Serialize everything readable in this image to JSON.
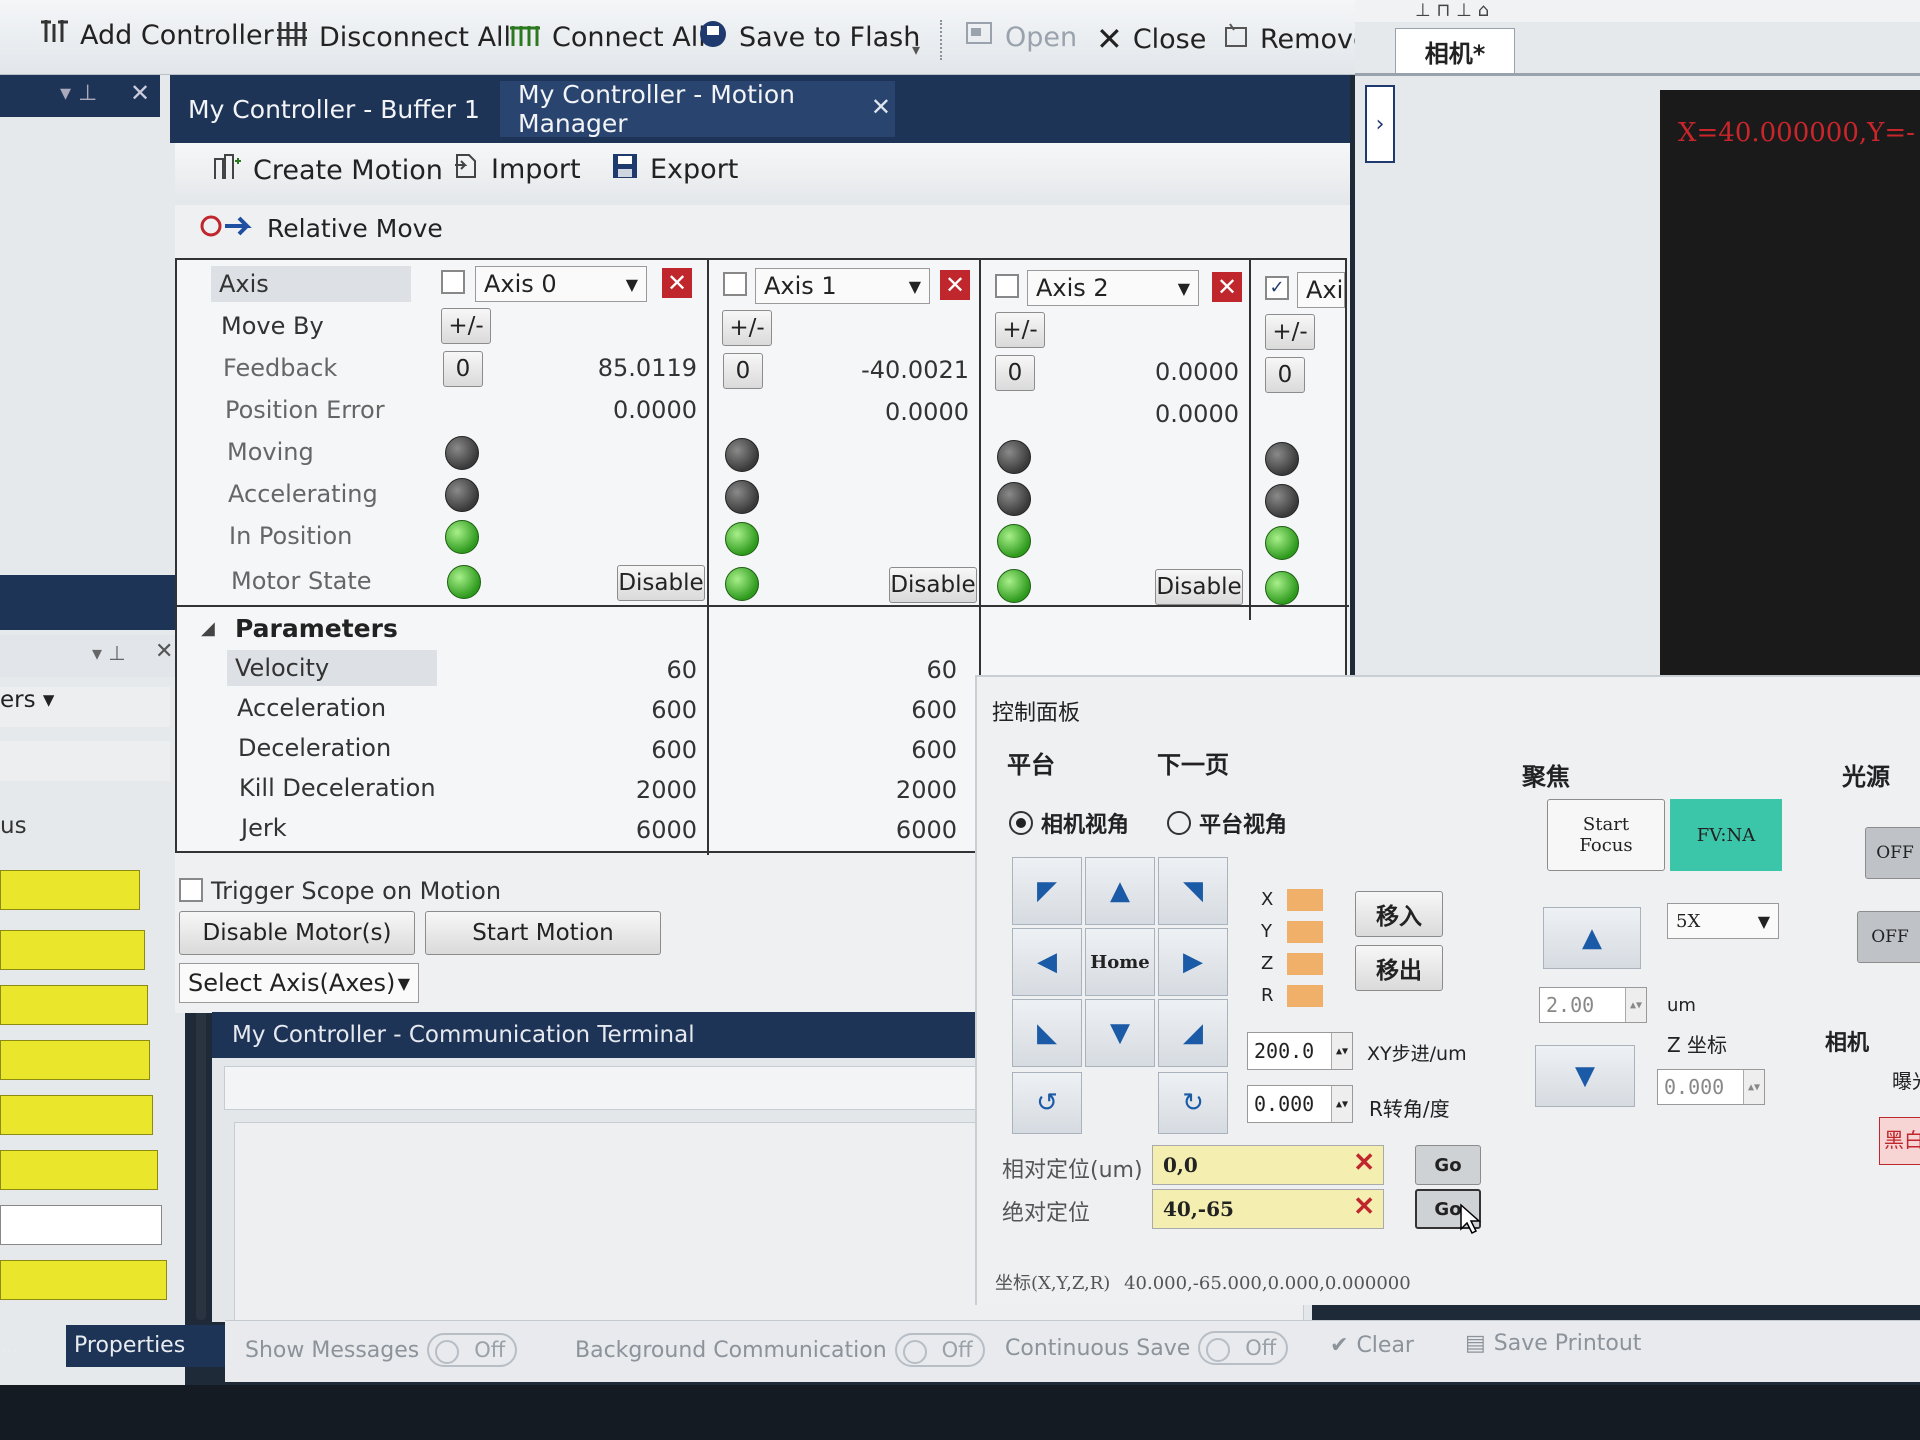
{
  "toolbar": {
    "add_controller": "Add Controller",
    "disconnect_all": "Disconnect All",
    "connect_all": "Connect All",
    "save_to_flash": "Save to Flash",
    "open": "Open",
    "close": "Close",
    "remove": "Remove"
  },
  "tabs": {
    "buffer": "My Controller - Buffer 1",
    "motion_manager": "My Controller - Motion Manager",
    "camera": "相机*"
  },
  "mm_toolbar": {
    "create_motion": "Create Motion",
    "import": "Import",
    "export": "Export"
  },
  "motion_type": "Relative Move",
  "row_labels": {
    "axis": "Axis",
    "move_by": "Move By",
    "feedback": "Feedback",
    "position_error": "Position Error",
    "moving": "Moving",
    "accelerating": "Accelerating",
    "in_position": "In Position",
    "motor_state": "Motor State"
  },
  "axes": [
    {
      "name": "Axis 0",
      "checked": false,
      "move_by": "+/-",
      "zero": "0",
      "feedback": "85.0119",
      "position_error": "0.0000",
      "disable": "Disable"
    },
    {
      "name": "Axis 1",
      "checked": false,
      "move_by": "+/-",
      "zero": "0",
      "feedback": "-40.0021",
      "position_error": "0.0000",
      "disable": "Disable"
    },
    {
      "name": "Axis 2",
      "checked": false,
      "move_by": "+/-",
      "zero": "0",
      "feedback": "0.0000",
      "position_error": "0.0000",
      "disable": "Disable"
    },
    {
      "name": "Axi",
      "checked": true,
      "move_by": "+/-",
      "zero": "0"
    }
  ],
  "parameters": {
    "header": "Parameters",
    "rows": [
      {
        "label": "Velocity",
        "v0": "60",
        "v1": "60"
      },
      {
        "label": "Acceleration",
        "v0": "600",
        "v1": "600"
      },
      {
        "label": "Deceleration",
        "v0": "600",
        "v1": "600"
      },
      {
        "label": "Kill Deceleration",
        "v0": "2000",
        "v1": "2000"
      },
      {
        "label": "Jerk",
        "v0": "6000",
        "v1": "6000"
      }
    ]
  },
  "bottom_controls": {
    "trigger_scope": "Trigger Scope on Motion",
    "disable_motors": "Disable Motor(s)",
    "start_motion": "Start Motion",
    "select_axis": "Select Axis(Axes)"
  },
  "terminal": {
    "title": "My Controller - Communication Terminal"
  },
  "left_panel": {
    "ers": "ers",
    "us": "us",
    "properties": "Properties",
    "dots": "..."
  },
  "camera_readout": "X=40.000000,Y=-",
  "control_panel": {
    "title": "控制面板",
    "platform": "平台",
    "next_page": "下一页",
    "focus": "聚焦",
    "light": "光源",
    "camera_view": "相机视角",
    "platform_view": "平台视角",
    "home": "Home",
    "axis_labels": [
      "X",
      "Y",
      "Z",
      "R"
    ],
    "move_in": "移入",
    "move_out": "移出",
    "xy_step_value": "200.0",
    "xy_step_label": "XY步进/um",
    "r_rot_value": "0.000",
    "r_rot_label": "R转角/度",
    "relative_label": "相对定位(um)",
    "relative_value": "0,0",
    "absolute_label": "绝对定位",
    "absolute_value": "40,-65",
    "go": "Go",
    "coords_label": "坐标(X,Y,Z,R)",
    "coords_value": "40.000,-65.000,0.000,0.000000",
    "start_focus": "Start Focus",
    "fv_na": "FV:NA",
    "zoom": "5X",
    "z_step_value": "2.00",
    "z_step_unit": "um",
    "z_coord_label": "Z 坐标",
    "z_coord_value": "0.000",
    "off1": "OFF",
    "off2": "OFF",
    "camera": "相机",
    "exposure": "曝光",
    "black": "黑白"
  },
  "status_bar": {
    "show_messages": "Show Messages",
    "background_comm": "Background Communication",
    "continuous_save": "Continuous Save",
    "off": "Off",
    "clear": "Clear",
    "save_printout": "Save Printout"
  },
  "colors": {
    "accent": "#1f3a6e",
    "led_green": "#2e9a1d",
    "teal": "#3cc6a9",
    "yellow": "#e9e62c"
  }
}
